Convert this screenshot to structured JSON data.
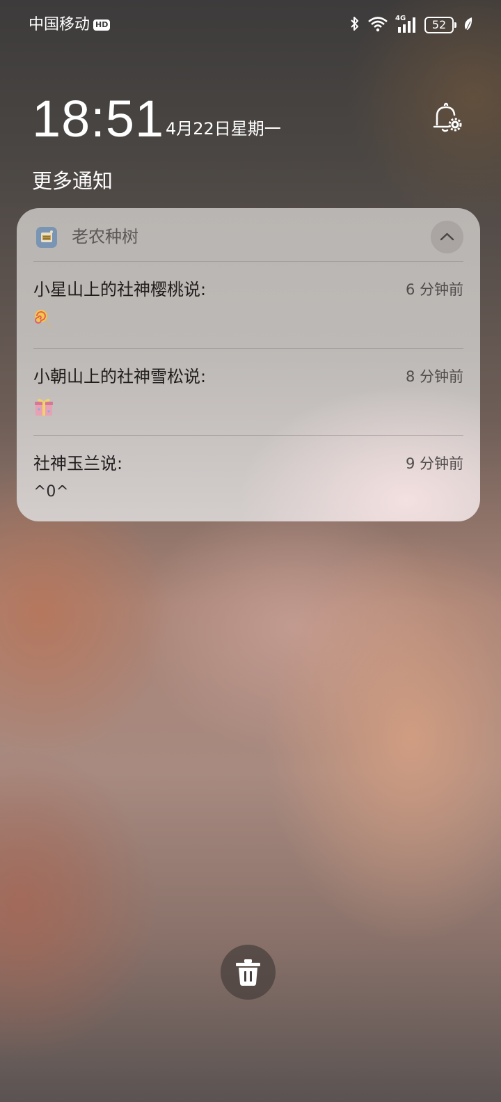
{
  "status_bar": {
    "carrier": "中国移动",
    "hd_badge": "HD",
    "network_type": "4G",
    "battery_level": "52",
    "icons": [
      "bluetooth-icon",
      "wifi-icon",
      "signal-icon",
      "battery-icon",
      "leaf-icon"
    ]
  },
  "lockscreen": {
    "time": "18:51",
    "date": "4月22日星期一",
    "section_title": "更多通知"
  },
  "notification_group": {
    "app_name": "老农种树",
    "notifications": [
      {
        "title": "小星山上的社神樱桃说:",
        "time": "6 分钟前",
        "body": "",
        "body_icon": "lollipop-icon"
      },
      {
        "title": "小朝山上的社神雪松说:",
        "time": "8 分钟前",
        "body": "",
        "body_icon": "gift-icon"
      },
      {
        "title": "社神玉兰说:",
        "time": "9 分钟前",
        "body": "^0^",
        "body_icon": ""
      }
    ]
  },
  "colors": {
    "card_background": "#bdb9b6",
    "trash_button": "#463e3c",
    "text_primary": "#1f1d1c"
  }
}
